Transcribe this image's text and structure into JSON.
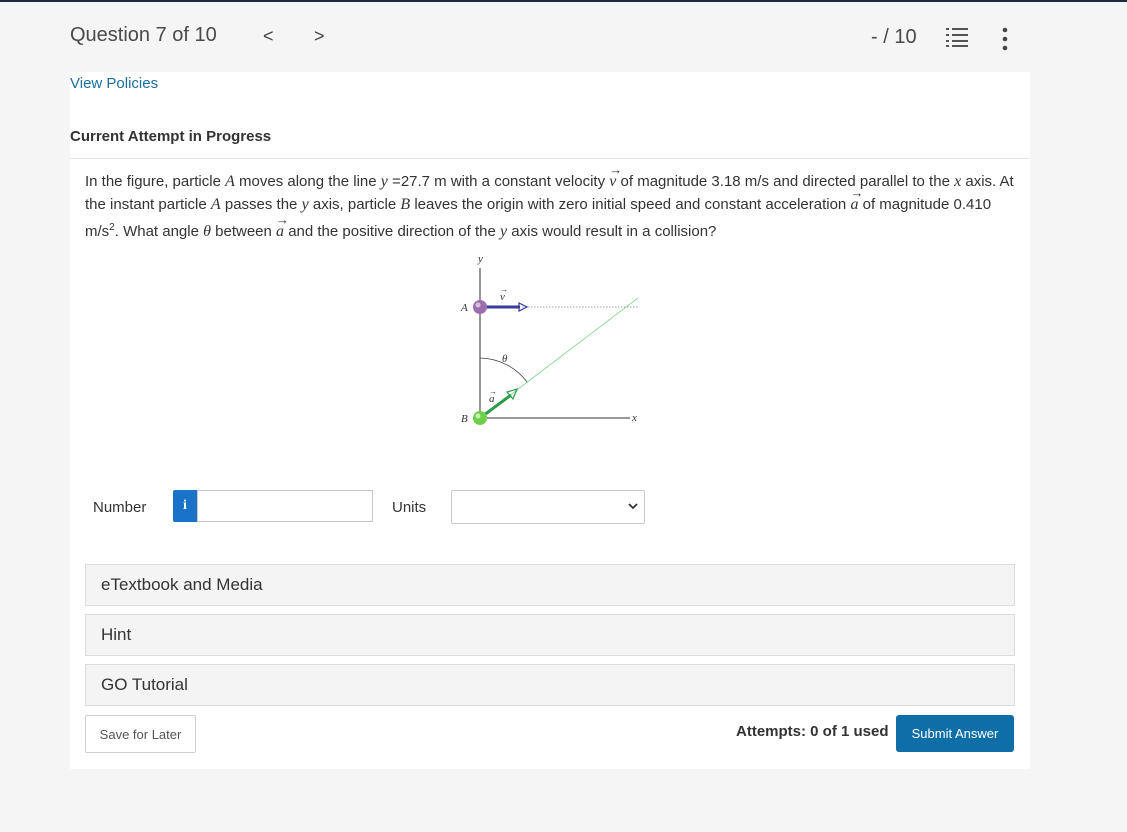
{
  "header": {
    "question_label": "Question 7 of 10",
    "prev_glyph": "<",
    "next_glyph": ">",
    "score": "- / 10",
    "list_icon": "question-list-icon",
    "more_icon": "more-vertical-icon"
  },
  "links": {
    "view_policies": "View Policies"
  },
  "attempt_heading": "Current Attempt in Progress",
  "question": {
    "t1": "In the figure, particle ",
    "pA": "A",
    "t2": " moves along the line ",
    "y1": "y",
    "t3": " =27.7 m with a constant velocity ",
    "v": "v",
    "t4": " of magnitude 3.18 m/s and directed parallel to the ",
    "x1": "x",
    "t5": " axis. At the instant particle ",
    "pA2": "A",
    "t6": " passes the ",
    "y2": "y",
    "t7": " axis, particle ",
    "pB": "B",
    "t8": " leaves the origin with zero initial speed and constant acceleration ",
    "a1": "a",
    "t9": " of magnitude 0.410 m/s",
    "sup": "2",
    "t10": ". What angle ",
    "theta": "θ",
    "t11": " between ",
    "a2": "a",
    "t12": " and the positive direction of the ",
    "y3": "y",
    "t13": " axis would result in a collision?"
  },
  "figure": {
    "y_axis": "y",
    "x_axis": "x",
    "label_A": "A",
    "label_B": "B",
    "label_v": "v",
    "label_a": "a",
    "label_theta": "θ",
    "colors": {
      "particle_A": "#9b6fae",
      "particle_B": "#6fcf4a",
      "velocity": "#3a3a9a",
      "acceleration": "#2e9a4a",
      "path": "#7ccf8a"
    }
  },
  "answer": {
    "number_label": "Number",
    "info_glyph": "i",
    "number_value": "",
    "units_label": "Units",
    "units_selected": ""
  },
  "accordions": {
    "etextbook": "eTextbook and Media",
    "hint": "Hint",
    "go_tutorial": "GO Tutorial"
  },
  "footer": {
    "save_label": "Save for Later",
    "attempts": "Attempts: 0 of 1 used",
    "submit_label": "Submit Answer"
  },
  "colors": {
    "accent": "#0e6fa8",
    "link": "#1a6fa0",
    "info": "#1a73c8"
  }
}
